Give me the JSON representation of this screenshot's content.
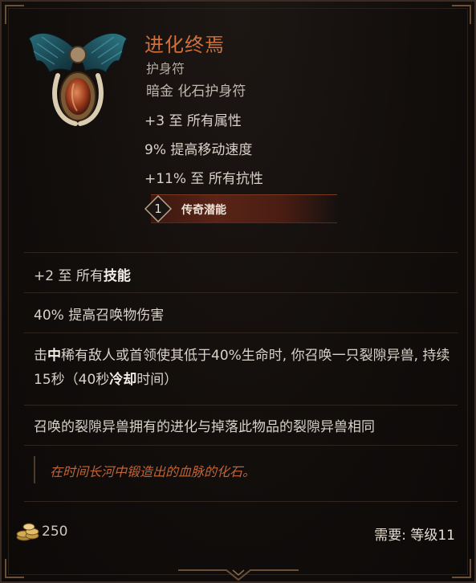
{
  "item": {
    "name": "进化终焉",
    "type": "护身符",
    "rarity": "暗金 化石护身符",
    "stats": [
      "+3 至 所有属性",
      "9% 提高移动速度",
      "+11% 至 所有抗性"
    ]
  },
  "legendary": {
    "count": "1",
    "label": "传奇潜能"
  },
  "affixes": {
    "skills_prefix": "+2 至 所有",
    "skills_keyword": "技能",
    "summon_damage": "40% 提高召唤物伤害",
    "proc_a": "击",
    "proc_b": "中",
    "proc_c": "稀有敌人或首领使其低于40%生命时, 你召唤一只裂隙异兽, 持续15秒（40秒",
    "proc_d": "冷却",
    "proc_e": "时间）",
    "beast_text": "召唤的裂隙异兽拥有的进化与掉落此物品的裂隙异兽相同"
  },
  "flavor_text": "在时间长河中锻造出的血脉的化石。",
  "footer": {
    "gold": "250",
    "requirement": "需要: 等级11"
  },
  "icons": {
    "item": "winged-amulet-icon",
    "gold": "gold-coins-icon"
  },
  "colors": {
    "name": "#d2703a",
    "flavor": "#c06438",
    "legendary_bar": "#5a2417"
  }
}
